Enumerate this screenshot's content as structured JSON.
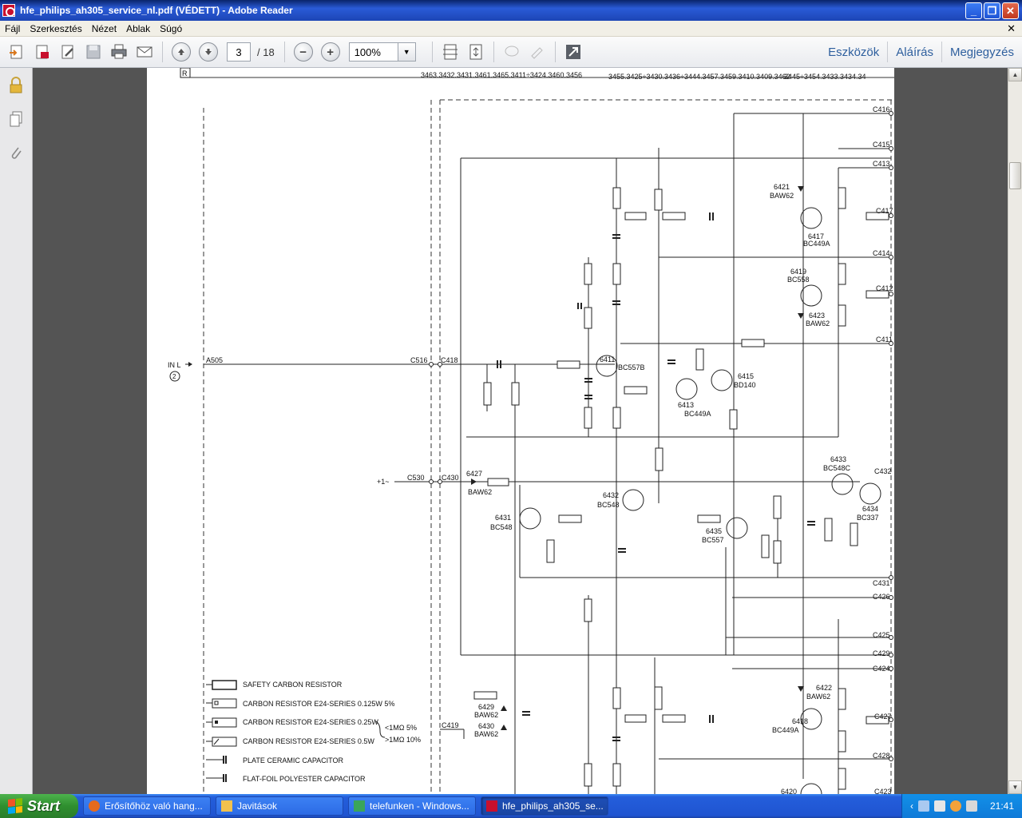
{
  "window": {
    "title": "hfe_philips_ah305_service_nl.pdf (VÉDETT) - Adobe Reader",
    "minimize": "_",
    "maximize": "❐",
    "close": "✕"
  },
  "menu": {
    "items": [
      "Fájl",
      "Szerkesztés",
      "Nézet",
      "Ablak",
      "Súgó"
    ],
    "close_doc": "✕"
  },
  "toolbar": {
    "current_page": "3",
    "total_pages": "/ 18",
    "zoom": "100%",
    "zoom_out": "−",
    "zoom_in": "+",
    "links": [
      "Eszközök",
      "Aláírás",
      "Megjegyzés"
    ]
  },
  "document": {
    "header_box": "R",
    "header_refs": [
      "3463.3432.3431.3461.3465.3411÷3424.3460.3456",
      "3455.3425÷3430.3436÷3444.3457.3459.3410.3409.3462",
      "3445÷3454.3433.3434.34"
    ],
    "input": {
      "label": "IN L",
      "sub": "2",
      "connector": "A505"
    },
    "supply_label": "+1~",
    "connectors": [
      "C516",
      "C418",
      "C530",
      "C430",
      "C419"
    ],
    "right_nodes": [
      "C416",
      "C415",
      "C413",
      "C417",
      "C414",
      "C412",
      "C411",
      "C432",
      "C431",
      "C426",
      "C425",
      "C429",
      "C424",
      "C427",
      "C428",
      "C423"
    ],
    "transistors": [
      {
        "ref": "6417",
        "type": "BC449A"
      },
      {
        "ref": "6419",
        "type": "BC558"
      },
      {
        "ref": "6411",
        "type": "BC557B"
      },
      {
        "ref": "6413",
        "type": "BC449A"
      },
      {
        "ref": "6415",
        "type": "BD140"
      },
      {
        "ref": "6433",
        "type": "BC548C"
      },
      {
        "ref": "6434",
        "type": "BC337"
      },
      {
        "ref": "6432",
        "type": "BC548"
      },
      {
        "ref": "6431",
        "type": "BC548"
      },
      {
        "ref": "6435",
        "type": "BC557"
      },
      {
        "ref": "6418",
        "type": "BC449A"
      },
      {
        "ref": "6420",
        "type": ""
      }
    ],
    "diodes": [
      {
        "ref": "6421",
        "type": "BAW62"
      },
      {
        "ref": "6423",
        "type": "BAW62"
      },
      {
        "ref": "6427",
        "type": "BAW62"
      },
      {
        "ref": "6422",
        "type": "BAW62"
      },
      {
        "ref": "6429",
        "type": "BAW62"
      },
      {
        "ref": "6430",
        "type": "BAW62"
      }
    ],
    "legend": [
      "SAFETY CARBON RESISTOR",
      "CARBON RESISTOR E24-SERIES 0.125W 5%",
      "CARBON RESISTOR E24-SERIES 0.25W",
      "CARBON RESISTOR E24-SERIES 0.5W",
      "PLATE CERAMIC CAPACITOR",
      "FLAT-FOIL POLYESTER CAPACITOR"
    ],
    "legend_tol": [
      "<1MΩ 5%",
      ">1MΩ 10%"
    ]
  },
  "taskbar": {
    "start": "Start",
    "tasks": [
      {
        "label": "Erősítőhöz való hang...",
        "icon_color": "#e66a1e"
      },
      {
        "label": "Javitások",
        "icon_color": "#f2c14e"
      },
      {
        "label": "telefunken - Windows...",
        "icon_color": "#3aa55a"
      },
      {
        "label": "hfe_philips_ah305_se...",
        "icon_color": "#c8102e"
      }
    ],
    "clock": "21:41"
  }
}
